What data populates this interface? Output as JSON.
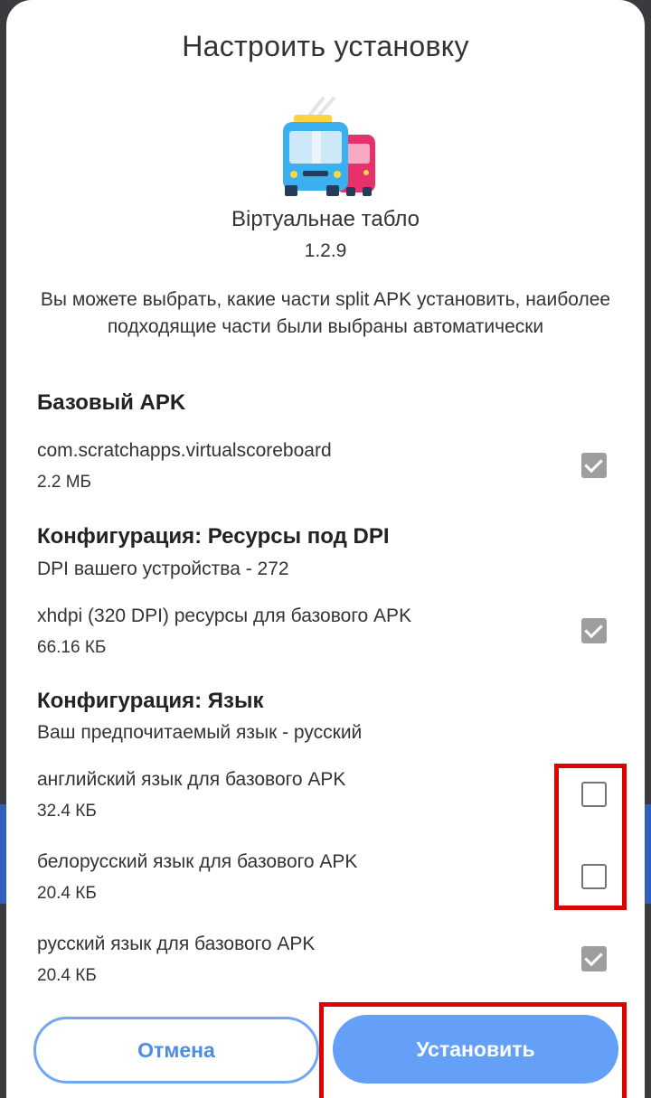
{
  "dialog": {
    "title": "Настроить установку",
    "app_icon": "trolleybus-icon",
    "app_name": "Віртуальнае табло",
    "app_version": "1.2.9",
    "description": "Вы можете выбрать, какие части split APK установить, наиболее подходящие части были выбраны автоматически"
  },
  "sections": {
    "base": {
      "title": "Базовый APK",
      "items": [
        {
          "name": "com.scratchapps.virtualscoreboard",
          "size": "2.2 МБ",
          "checked": true
        }
      ]
    },
    "dpi": {
      "title": "Конфигурация: Ресурсы под DPI",
      "subtitle": "DPI вашего устройства - 272",
      "items": [
        {
          "name": "xhdpi (320 DPI) ресурсы для базового APK",
          "size": "66.16 КБ",
          "checked": true
        }
      ]
    },
    "lang": {
      "title": "Конфигурация: Язык",
      "subtitle": "Ваш предпочитаемый язык - русский",
      "items": [
        {
          "name": "английский язык для базового APK",
          "size": "32.4 КБ",
          "checked": false
        },
        {
          "name": "белорусский язык для базового APK",
          "size": "20.4 КБ",
          "checked": false
        },
        {
          "name": "русский язык для базового APK",
          "size": "20.4 КБ",
          "checked": true
        }
      ]
    }
  },
  "buttons": {
    "cancel": "Отмена",
    "install": "Установить"
  },
  "colors": {
    "accent": "#64a0f8",
    "highlight": "#e00000",
    "checkbox_checked": "#9e9e9e"
  }
}
